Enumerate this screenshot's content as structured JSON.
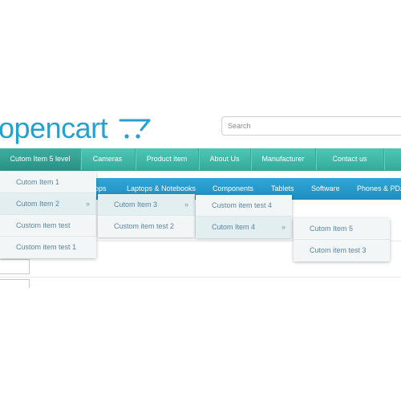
{
  "logo": {
    "text": "opencart"
  },
  "search": {
    "placeholder": "Search"
  },
  "top_nav": {
    "items": [
      {
        "label": "Cutom Item 5 level"
      },
      {
        "label": "Cameras"
      },
      {
        "label": "Product item"
      },
      {
        "label": "About Us"
      },
      {
        "label": "Manufacturer"
      },
      {
        "label": "Contact us"
      }
    ]
  },
  "sub_nav": {
    "items": [
      {
        "label": "ops"
      },
      {
        "label": "Laptops & Notebooks"
      },
      {
        "label": "Components"
      },
      {
        "label": "Tablets"
      },
      {
        "label": "Software"
      },
      {
        "label": "Phones & PDA"
      }
    ]
  },
  "dropdown_level1": {
    "items": [
      {
        "label": "Cutom Item 1"
      },
      {
        "label": "Cutom Item 2",
        "arrow": "»"
      },
      {
        "label": "Custom item test"
      },
      {
        "label": "Custom item test 1"
      }
    ]
  },
  "dropdown_level2": {
    "items": [
      {
        "label": "Cutom Item 3",
        "arrow": "»"
      },
      {
        "label": "Custom item test 2"
      }
    ]
  },
  "dropdown_level3": {
    "items": [
      {
        "label": "Custom item test 4"
      },
      {
        "label": "Cutom Item 4",
        "arrow": "»"
      }
    ]
  },
  "dropdown_level4": {
    "items": [
      {
        "label": "Cutom Item 5"
      },
      {
        "label": "Cutom item test 3"
      }
    ]
  },
  "colors": {
    "logo": "#23a1d1",
    "top_nav": "#3fb8a8",
    "sub_nav": "#2a9fd0",
    "dropdown_text": "#5c84a0",
    "dropdown_bg": "#f3f6f6"
  }
}
